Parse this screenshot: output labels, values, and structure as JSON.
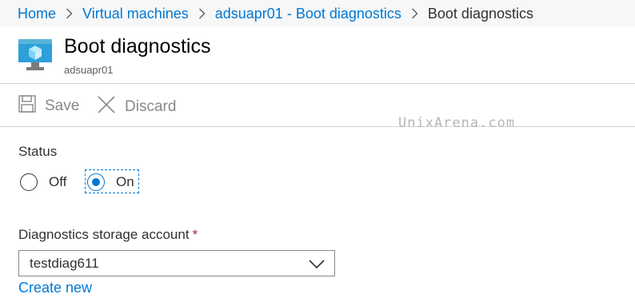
{
  "breadcrumb": {
    "items": [
      "Home",
      "Virtual machines",
      "adsuapr01 - Boot diagnostics"
    ],
    "current": "Boot diagnostics"
  },
  "header": {
    "title": "Boot diagnostics",
    "subtitle": "adsuapr01",
    "icon": "virtual-machine-icon"
  },
  "toolbar": {
    "save_label": "Save",
    "discard_label": "Discard"
  },
  "watermark": "UnixArena.com",
  "status": {
    "label": "Status",
    "options": [
      "Off",
      "On"
    ],
    "selected": "On"
  },
  "storage": {
    "label": "Diagnostics storage account",
    "required_marker": "*",
    "value": "testdiag611",
    "create_new_label": "Create new"
  },
  "colors": {
    "accent": "#0078d4",
    "required": "#a4262c",
    "disabled_text": "#8a8886"
  }
}
